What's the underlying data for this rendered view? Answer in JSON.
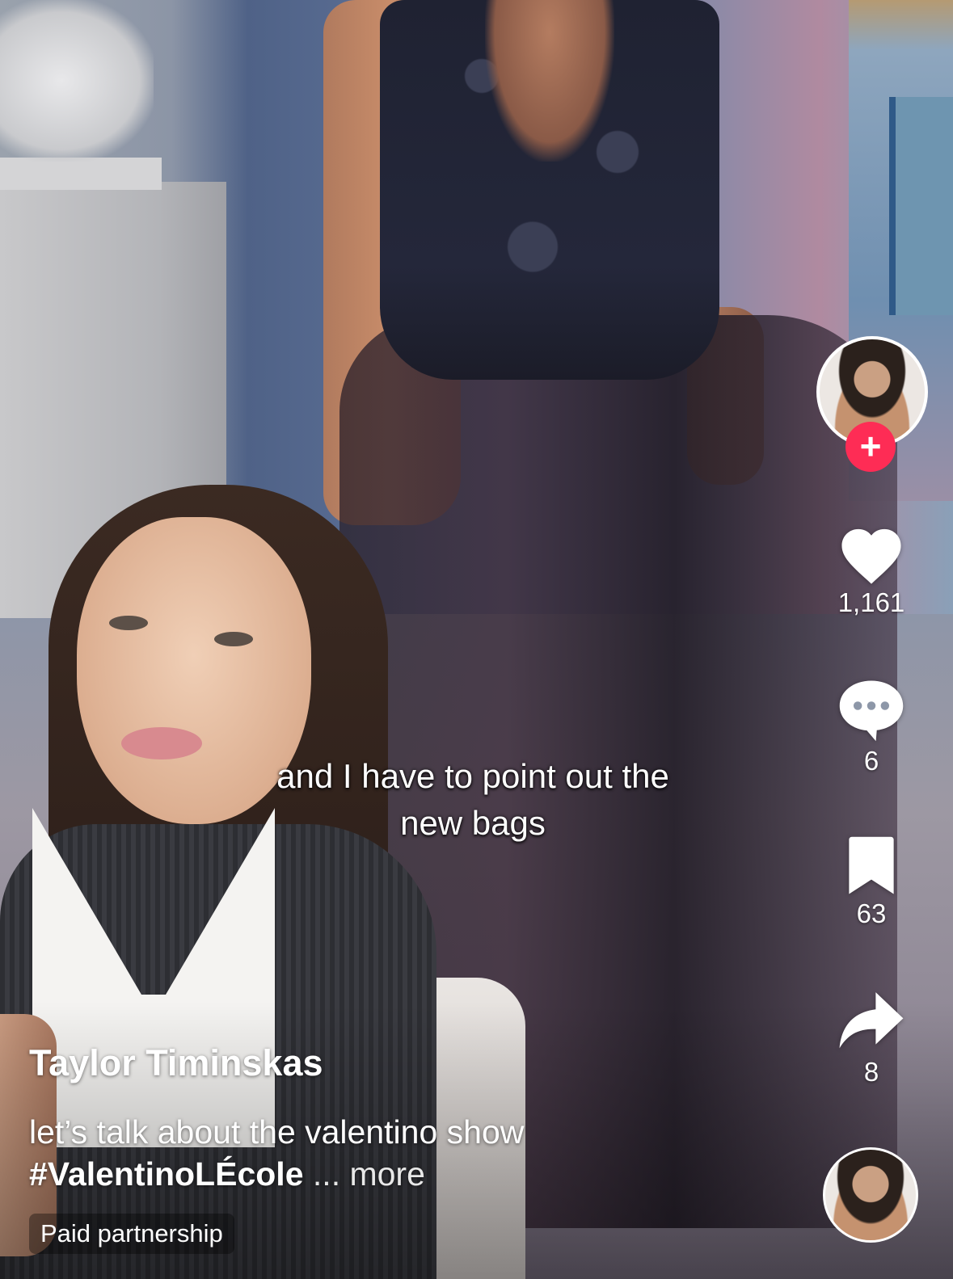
{
  "video": {
    "caption_line1": "and I have to point out the",
    "caption_line2": "new bags"
  },
  "post": {
    "author": "Taylor Timinskas",
    "description": "let’s talk about the valentino show",
    "hashtag": "#ValentinoLÉcole",
    "more_label": "... more",
    "paid_label": "Paid partnership"
  },
  "sidebar": {
    "follow_icon": "plus-icon",
    "like_count": "1,161",
    "comment_count": "6",
    "bookmark_count": "63",
    "share_count": "8"
  },
  "colors": {
    "follow_button": "#fe2c55",
    "icon": "#ffffff"
  }
}
